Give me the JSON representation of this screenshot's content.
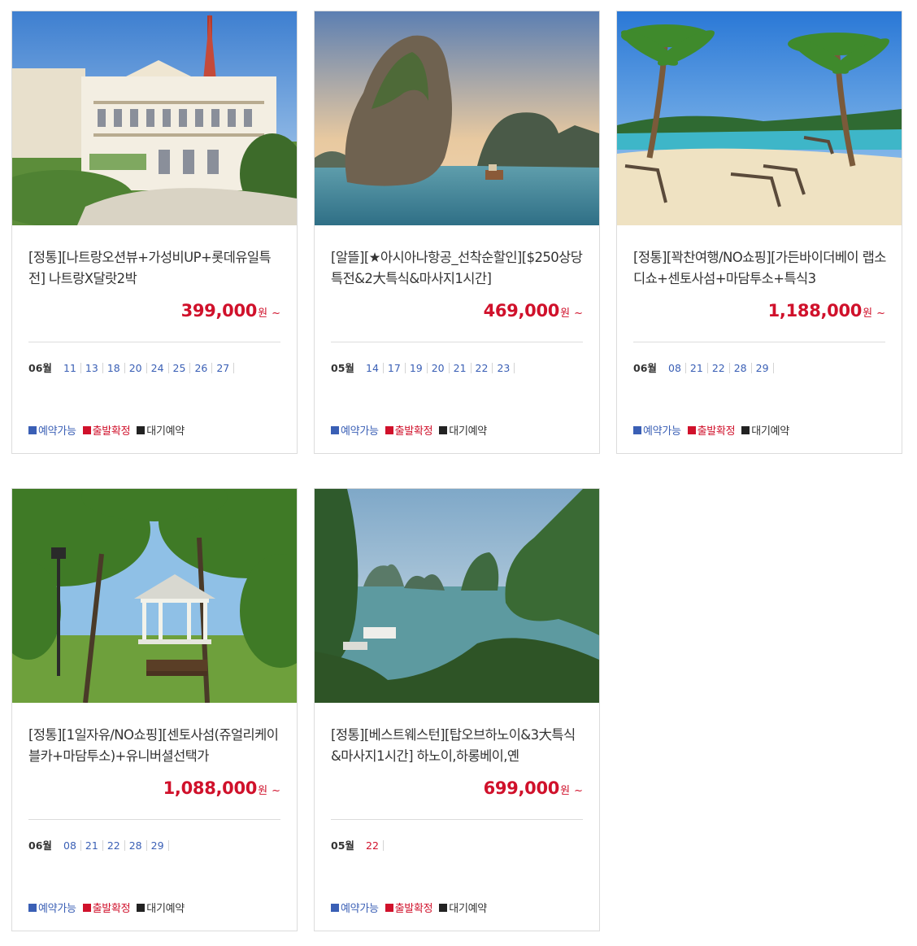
{
  "colors": {
    "price": "#d0112b",
    "available": "#3a5fb5",
    "confirmed": "#d0112b",
    "waiting": "#222222"
  },
  "legend": {
    "available": "예약가능",
    "confirmed": "출발확정",
    "waiting": "대기예약"
  },
  "products": [
    {
      "image": "hotel-palace-photo",
      "title": "[정통][나트랑오션뷰+가성비UP+롯데유일특전] 나트랑X달랏2박",
      "price": "399,000",
      "currency": "원",
      "suffix": "~",
      "month": "06월",
      "dates": [
        "11",
        "13",
        "18",
        "20",
        "24",
        "25",
        "26",
        "27"
      ]
    },
    {
      "image": "halong-rock-island-photo",
      "title": "[알뜰][★아시아나항공_선착순할인][$250상당특전&2大특식&마사지1시간]",
      "price": "469,000",
      "currency": "원",
      "suffix": "~",
      "month": "05월",
      "dates": [
        "14",
        "17",
        "19",
        "20",
        "21",
        "22",
        "23"
      ]
    },
    {
      "image": "tropical-beach-photo",
      "title": "[정통][꽉찬여행/NO쇼핑][가든바이더베이 랩소디쇼+센토사섬+마담투소+특식3",
      "price": "1,188,000",
      "currency": "원",
      "suffix": "~",
      "month": "06월",
      "dates": [
        "08",
        "21",
        "22",
        "28",
        "29"
      ]
    },
    {
      "image": "garden-gazebo-photo",
      "title": "[정통][1일자유/NO쇼핑][센토사섬(쥬얼리케이블카+마담투소)+유니버셜선택가",
      "price": "1,088,000",
      "currency": "원",
      "suffix": "~",
      "month": "06월",
      "dates": [
        "08",
        "21",
        "22",
        "28",
        "29"
      ]
    },
    {
      "image": "halong-bay-photo",
      "title": "[정통][베스트웨스턴][탑오브하노이&3大특식&마사지1시간] 하노이,하롱베이,옌",
      "price": "699,000",
      "currency": "원",
      "suffix": "~",
      "month": "05월",
      "dates": [
        "22"
      ],
      "dates_confirmed": true
    }
  ]
}
